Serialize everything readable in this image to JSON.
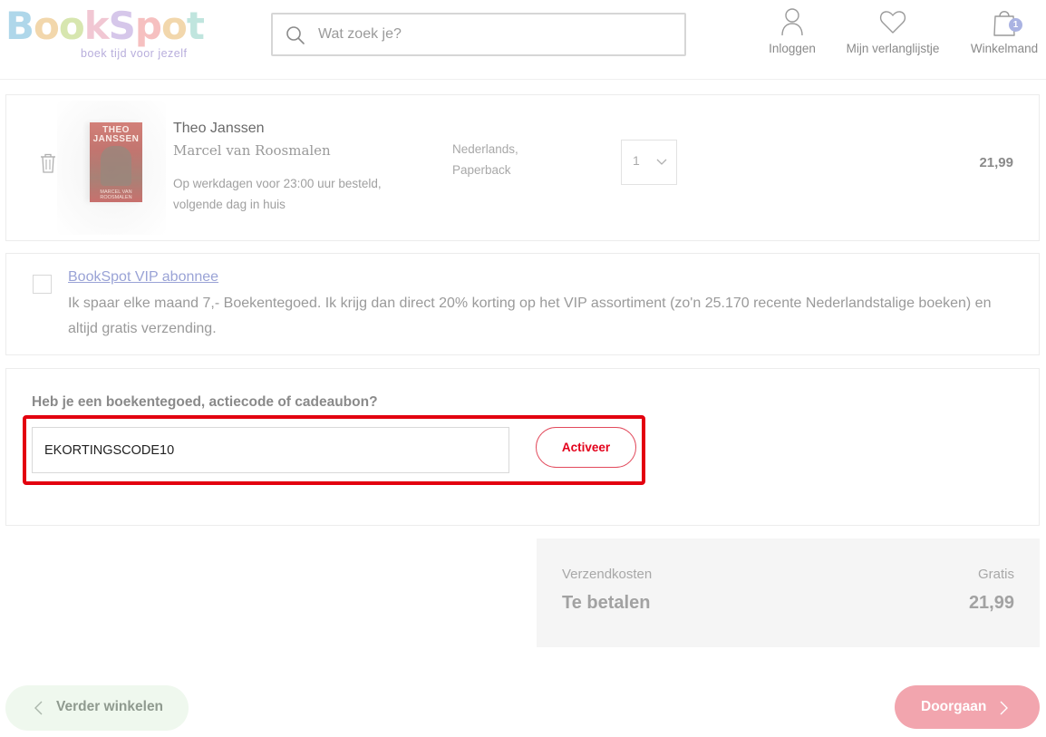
{
  "header": {
    "logo_text": "BookSpot",
    "logo_tagline": "boek tijd voor jezelf",
    "search": {
      "placeholder": "Wat zoek je?",
      "value": ""
    },
    "nav": {
      "login_label": "Inloggen",
      "wishlist_label": "Mijn verlanglijstje",
      "cart_label": "Winkelmand",
      "cart_count": "1"
    }
  },
  "cart": {
    "items": [
      {
        "title": "Theo Janssen",
        "author": "Marcel van Roosmalen",
        "delivery": "Op werkdagen voor 23:00 uur besteld, volgende dag in huis",
        "format": "Nederlands, Paperback",
        "quantity": "1",
        "price": "21,99",
        "cover_title": "THEO JANSSEN",
        "cover_author": "MARCEL VAN ROOSMALEN"
      }
    ]
  },
  "vip": {
    "link_label": "BookSpot VIP abonnee",
    "description": "Ik spaar elke maand 7,- Boekentegoed. Ik krijg dan direct 20% korting op het VIP assortiment (zo'n 25.170 recente Nederlandstalige boeken) en altijd gratis verzending.",
    "checked": false
  },
  "voucher": {
    "label": "Heb je een boekentegoed, actiecode of cadeaubon?",
    "code_value": "EKORTINGSCODE10",
    "activate_label": "Activeer",
    "highlight_color": "#e3000f"
  },
  "summary": {
    "shipping_label": "Verzendkosten",
    "shipping_value": "Gratis",
    "total_label": "Te betalen",
    "total_value": "21,99"
  },
  "footer": {
    "continue_label": "Verder winkelen",
    "proceed_label": "Doorgaan"
  },
  "colors": {
    "accent_red": "#e3001b",
    "proceed_bg": "#f2a5ae",
    "continue_bg": "#eff8ee",
    "vip_link": "#9aa3d6",
    "badge": "#aab3e2"
  }
}
